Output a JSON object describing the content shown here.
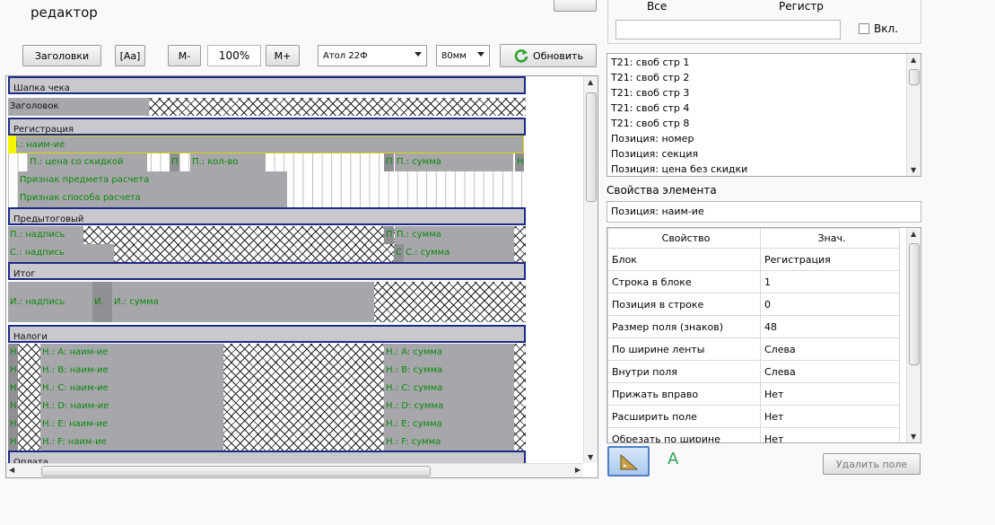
{
  "window": {
    "title": "редактор"
  },
  "toolbar": {
    "headers_label": "Заголовки",
    "case_label": "[Aa]",
    "zoom_out_label": "M-",
    "zoom_value": "100%",
    "zoom_in_label": "M+",
    "printer_selected": "Атол 22Ф",
    "width_selected": "80мм",
    "refresh_label": "Обновить"
  },
  "filter": {
    "col_all": "Все",
    "col_register": "Регистр",
    "search_value": "",
    "enable_label": "Вкл.",
    "enable_checked": false
  },
  "field_list": [
    "Т21: своб стр 1",
    "Т21: своб стр 2",
    "Т21: своб стр 3",
    "Т21: своб стр 4",
    "Т21: своб стр 8",
    "Позиция: номер",
    "Позиция: секция",
    "Позиция: цена без скидки"
  ],
  "element_props": {
    "title": "Свойства элемента",
    "selected_element": "Позиция: наим-ие",
    "header_property": "Свойство",
    "header_value": "Знач.",
    "rows": [
      {
        "name": "Блок",
        "value": "Регистрация"
      },
      {
        "name": "Строка в блоке",
        "value": "1"
      },
      {
        "name": "Позиция в строке",
        "value": "0"
      },
      {
        "name": "Размер поля (знаков)",
        "value": "48"
      },
      {
        "name": "По ширине ленты",
        "value": "Слева"
      },
      {
        "name": "Внутри поля",
        "value": "Слева"
      },
      {
        "name": "Прижать вправо",
        "value": "Нет"
      },
      {
        "name": "Расширить поле",
        "value": "Нет"
      },
      {
        "name": "Обрезать по ширине",
        "value": "Нет"
      }
    ]
  },
  "bottom": {
    "text_tool_label": "A",
    "delete_label": "Удалить поле"
  },
  "editor": {
    "block_header": "Шапка чека",
    "header_field": "Заголовок",
    "block_registration": "Регистрация",
    "pos_name": "П.: наим-ие",
    "pos_price": "П.: цена со скидкой",
    "pos_p": "П",
    "pos_qty": "П.: кол-во",
    "pos_p2": "П",
    "pos_sum": "П.: сумма",
    "pos_h": "Н",
    "subject_sign": "Признак предмета расчета",
    "method_sign": "Признак способа расчета",
    "block_pretotal": "Предытоговый",
    "pre_label": "П.: надпись",
    "pre_p": "П",
    "pre_sum": "П.: сумма",
    "disc_label": "С.: надпись",
    "disc_c": "С",
    "disc_sum": "С.: сумма",
    "block_total": "Итог",
    "total_label": "И.: надпись",
    "total_i": "И.",
    "total_sum": "И.: сумма",
    "block_taxes": "Налоги",
    "taxes": [
      {
        "h": "Н",
        "name": "Н.: A: наим-ие",
        "sum": "Н.: A: сумма"
      },
      {
        "h": "Н",
        "name": "Н.: B: наим-ие",
        "sum": "Н.: B: сумма"
      },
      {
        "h": "Н",
        "name": "Н.: C: наим-ие",
        "sum": "Н.: C: сумма"
      },
      {
        "h": "Н",
        "name": "Н.: D: наим-ие",
        "sum": "Н.: D: сумма"
      },
      {
        "h": "Н",
        "name": "Н.: E: наим-ие",
        "sum": "Н.: E: сумма"
      },
      {
        "h": "Н",
        "name": "Н.: F: наим-ие",
        "sum": "Н.: F: сумма"
      }
    ],
    "block_payment": "Оплата"
  }
}
